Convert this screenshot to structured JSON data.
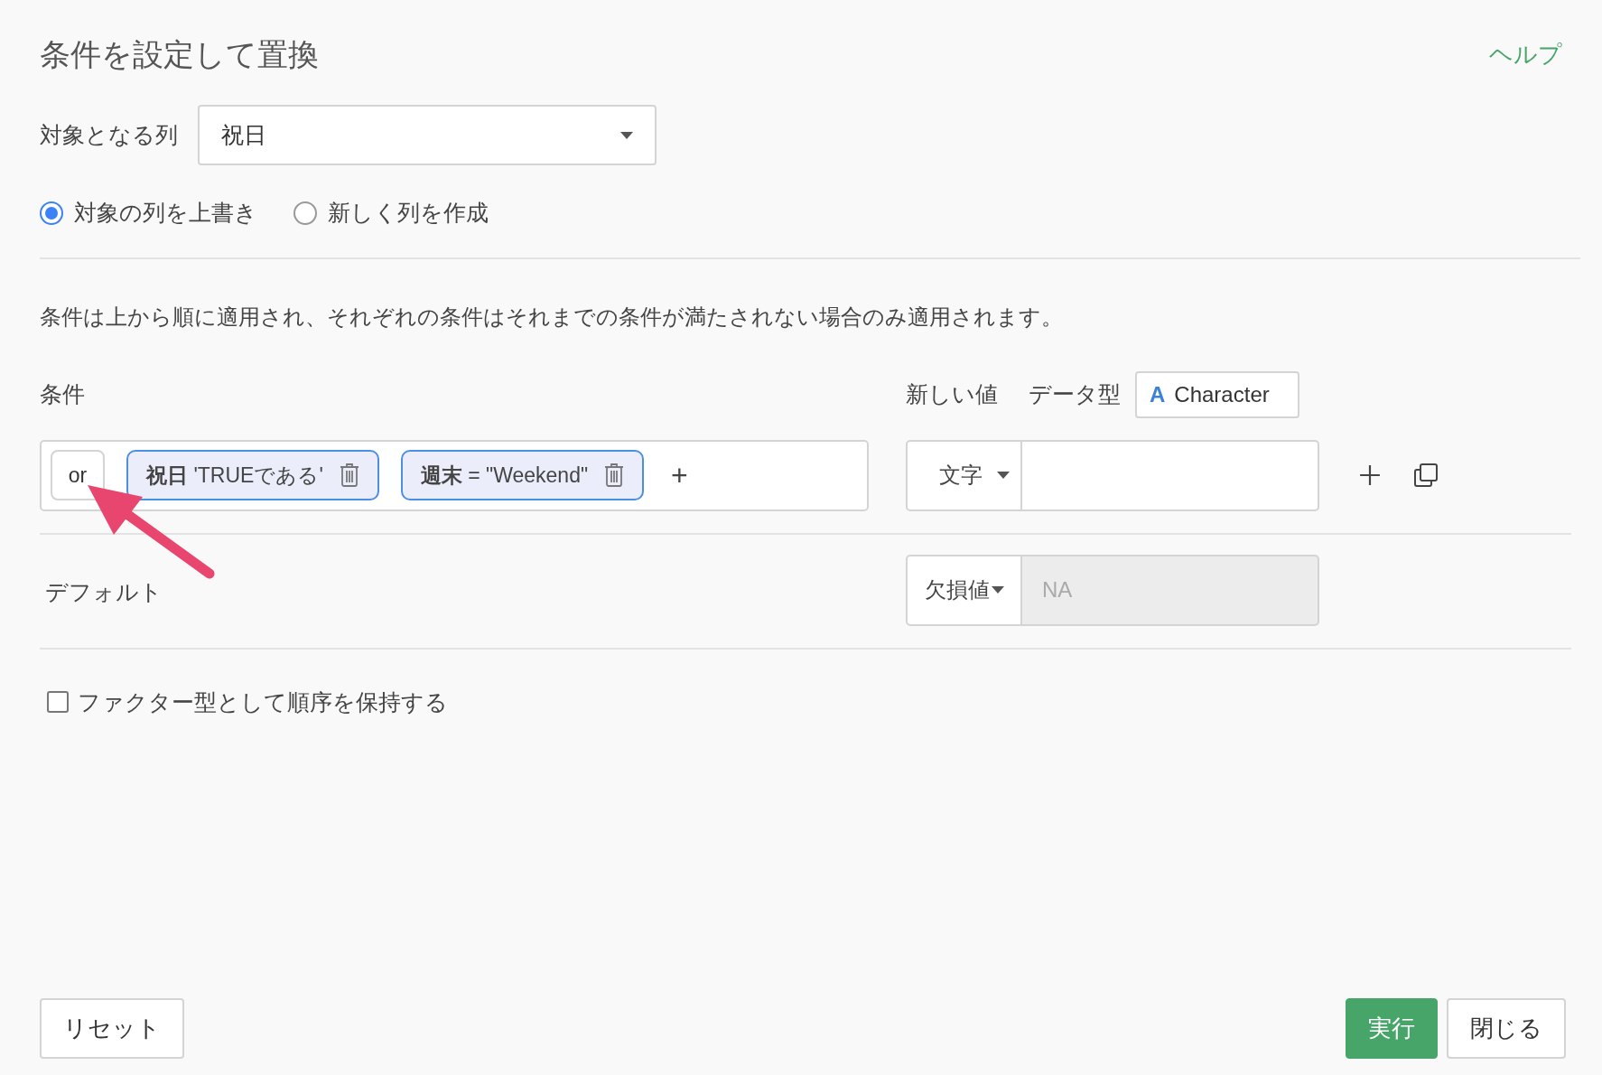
{
  "dialog": {
    "title": "条件を設定して置換",
    "help_link": "ヘルプ"
  },
  "target_column": {
    "label": "対象となる列",
    "value": "祝日"
  },
  "output_options": [
    {
      "label": "対象の列を上書き",
      "selected": true
    },
    {
      "label": "新しく列を作成",
      "selected": false
    }
  ],
  "description": "条件は上から順に適用され、それぞれの条件はそれまでの条件が満たされない場合のみ適用されます。",
  "conditions_header": {
    "label": "条件",
    "new_value_label": "新しい値",
    "data_type_label": "データ型",
    "data_type": {
      "icon": "A",
      "value": "Character"
    }
  },
  "rules": [
    {
      "operator": "or",
      "conditions": [
        "**祝日** 'TRUEである'",
        "**週末** = \"Weekend\""
      ],
      "add_symbol": "+",
      "value_type": "文字"
    }
  ],
  "default": {
    "label": "デフォルト",
    "value_type": "欠損値",
    "value": "NA",
    "disabled": true
  },
  "factor_option": {
    "label": "ファクター型として順序を保持する",
    "checked": false
  },
  "left_buttons": [
    {
      "label": "リセット"
    }
  ],
  "right_buttons": [
    {
      "label": "実行",
      "kind": "primary"
    },
    {
      "label": "閉じる",
      "kind": "default"
    }
  ]
}
